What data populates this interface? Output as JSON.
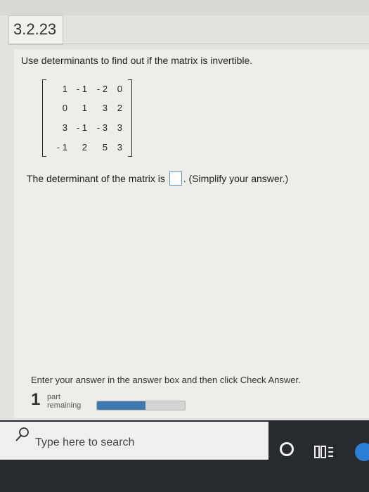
{
  "exercise": {
    "number": "3.2.23"
  },
  "question": {
    "text": "Use determinants to find out if the matrix is invertible.",
    "matrix": [
      [
        "1",
        "- 1",
        "- 2",
        "0"
      ],
      [
        "0",
        "1",
        "3",
        "2"
      ],
      [
        "3",
        "- 1",
        "- 3",
        "3"
      ],
      [
        "- 1",
        "2",
        "5",
        "3"
      ]
    ],
    "prompt_before": "The determinant of the matrix is",
    "prompt_after": ". (Simplify your answer.)"
  },
  "footer": {
    "instruction": "Enter your answer in the answer box and then click Check Answer.",
    "parts_remaining_number": "1",
    "parts_remaining_text_line1": "part",
    "parts_remaining_text_line2": "remaining",
    "progress_fraction": 0.55
  },
  "taskbar": {
    "search_placeholder": "Type here to search",
    "icons": [
      "search-icon",
      "cortana-icon",
      "task-view-icon",
      "edge-icon"
    ]
  },
  "colors": {
    "progress_fill": "#3e7ab0",
    "answer_box_border": "#5a8fc0",
    "taskbar_bg": "#272a2e"
  }
}
